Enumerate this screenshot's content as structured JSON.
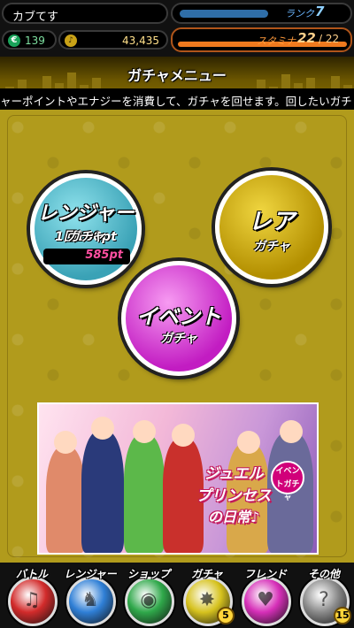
{
  "status": {
    "player_name": "カブてす",
    "rank_label": "ランク",
    "rank_value": "7",
    "coins": "139",
    "gold": "43,435",
    "stamina_label": "スタミナ",
    "stamina_current": "22",
    "stamina_max": "/ 22",
    "coin_icon": "coin-icon",
    "gold_icon": "gold-icon"
  },
  "header": {
    "title": "ガチャメニュー",
    "ticker": "ャーポイントやエナジーを消費して、ガチャを回せます。回したいガチ"
  },
  "gacha": {
    "ranger": {
      "cost": "1回100pt",
      "title": "レンジャー",
      "subtitle": "ガチャ",
      "points": "585pt"
    },
    "rare": {
      "title": "レア",
      "subtitle": "ガチャ"
    },
    "event": {
      "title": "イベント",
      "subtitle": "ガチャ"
    }
  },
  "banner": {
    "line1": "ジュエル",
    "line2": "プリンセス",
    "line3": "の日常♪",
    "tag": "イベントガチャ"
  },
  "nav": [
    {
      "label": "バトル",
      "color": "#d22b2b",
      "icon": "battle-icon"
    },
    {
      "label": "レンジャー",
      "color": "#2f7fd6",
      "icon": "ranger-icon"
    },
    {
      "label": "ショップ",
      "color": "#2fa84a",
      "icon": "shop-icon"
    },
    {
      "label": "ガチャ",
      "color": "#d6c21e",
      "icon": "gacha-icon",
      "badge": "5"
    },
    {
      "label": "フレンド",
      "color": "#d62fb8",
      "icon": "friend-icon"
    },
    {
      "label": "その他",
      "color": "#8a8a8a",
      "icon": "other-icon",
      "badge": "15"
    }
  ]
}
